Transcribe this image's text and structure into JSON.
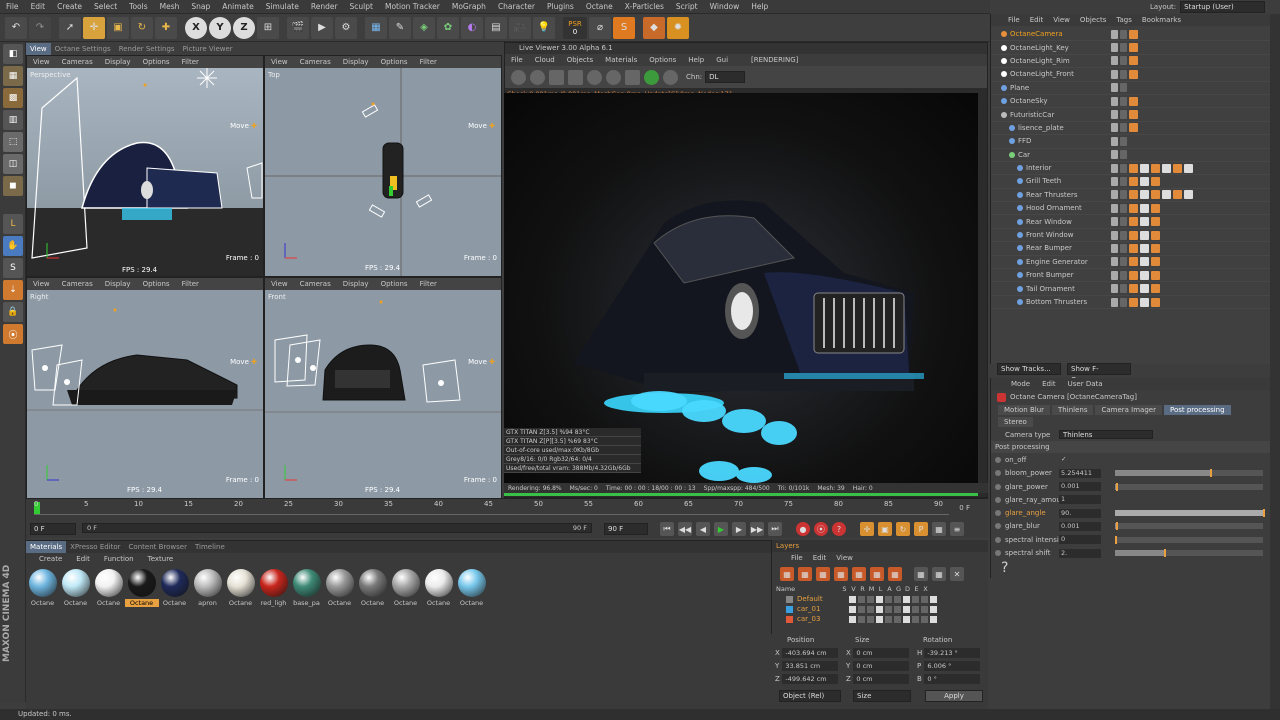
{
  "menu": [
    "File",
    "Edit",
    "Create",
    "Select",
    "Tools",
    "Mesh",
    "Snap",
    "Animate",
    "Simulate",
    "Render",
    "Sculpt",
    "Motion Tracker",
    "MoGraph",
    "Character",
    "Plugins",
    "Octane",
    "X-Particles",
    "Script",
    "Window",
    "Help"
  ],
  "layout": {
    "label": "Layout:",
    "value": "Startup (User)"
  },
  "psr": {
    "label": "PSR",
    "value": "0"
  },
  "editorTabs": [
    "View",
    "Octane Settings",
    "Render Settings",
    "Picture Viewer"
  ],
  "vpMenu": [
    "View",
    "Cameras",
    "Display",
    "Options",
    "Filter"
  ],
  "viewports": [
    {
      "name": "Perspective",
      "fps": "FPS : 29.4",
      "frame": "Frame : 0",
      "move": "Move"
    },
    {
      "name": "Top",
      "fps": "FPS : 29.4",
      "frame": "Frame : 0",
      "move": "Move"
    },
    {
      "name": "Right",
      "fps": "FPS : 29.4",
      "frame": "Frame : 0",
      "move": "Move"
    },
    {
      "name": "Front",
      "fps": "FPS : 29.4",
      "frame": "Frame : 0",
      "move": "Move"
    }
  ],
  "liveViewer": {
    "title": "Live Viewer 3.00 Alpha 6.1",
    "menu": [
      "File",
      "Cloud",
      "Objects",
      "Materials",
      "Options",
      "Help",
      "Gui"
    ],
    "rendering": "[RENDERING]",
    "chn": "Chn:",
    "chnValue": "DL",
    "check": "Check:0.001ms./0.001ms. MeshGen:0ms. Update[C]:0ms. Nodes:171",
    "stats": [
      "GTX TITAN Z[3.5]   %94   83°C",
      "GTX TITAN Z[P][3.5]   %69   83°C",
      "Out-of-core used/max:0Kb/8Gb",
      "Grey8/16: 0/0       Rgb32/64: 0/4",
      "Used/free/total vram: 388Mb/4.32Gb/6Gb"
    ],
    "status": [
      "Rendering: 96.8%",
      "Ms/sec: 0",
      "Time: 00 : 00 : 18/00 : 00 : 13",
      "Spp/maxspp: 484/500",
      "Tri: 0/101k",
      "Mesh: 39",
      "Hair: 0"
    ]
  },
  "timeline": {
    "ticks": [
      "0",
      "5",
      "10",
      "15",
      "20",
      "25",
      "30",
      "35",
      "40",
      "45",
      "50",
      "55",
      "60",
      "65",
      "70",
      "75",
      "80",
      "85",
      "90"
    ],
    "end": "0 F",
    "start": "0 F",
    "current": "0 F",
    "max": "90 F",
    "range": "90 F"
  },
  "materials": {
    "tabs": [
      "Materials",
      "XPresso Editor",
      "Content Browser",
      "Timeline"
    ],
    "menu": [
      "Create",
      "Edit",
      "Function",
      "Texture"
    ],
    "items": [
      {
        "name": "Octane",
        "color": "#6fb6e0"
      },
      {
        "name": "Octane",
        "color": "#bfe8f6"
      },
      {
        "name": "Octane",
        "color": "#f2f2f2"
      },
      {
        "name": "Octane",
        "color": "#1a1a1a"
      },
      {
        "name": "Octane",
        "color": "#1f2a5a"
      },
      {
        "name": "apron",
        "color": "#bdbdbd"
      },
      {
        "name": "Octane",
        "color": "#e6e2d6"
      },
      {
        "name": "red_ligh",
        "color": "#c8261c"
      },
      {
        "name": "base_pa",
        "color": "#3e8a76"
      },
      {
        "name": "Octane",
        "color": "#9a9a9a"
      },
      {
        "name": "Octane",
        "color": "#7a7a7a"
      },
      {
        "name": "Octane",
        "color": "#a8a8a8"
      },
      {
        "name": "Octane",
        "color": "#ececec"
      },
      {
        "name": "Octane",
        "color": "#78c8ec"
      }
    ]
  },
  "objects": {
    "menu": [
      "File",
      "Edit",
      "View",
      "Objects",
      "Tags",
      "Bookmarks"
    ],
    "rows": [
      {
        "name": "OctaneCamera",
        "color": "#e88f3c"
      },
      {
        "name": "OctaneLight_Key",
        "color": "#ffffff"
      },
      {
        "name": "OctaneLight_Rim",
        "color": "#ffffff"
      },
      {
        "name": "OctaneLight_Front",
        "color": "#ffffff"
      },
      {
        "name": "Plane",
        "color": "#6fa0e0"
      },
      {
        "name": "OctaneSky",
        "color": "#6fa0e0"
      },
      {
        "name": "FuturisticCar",
        "color": "#bbbbbb"
      },
      {
        "name": "lisence_plate",
        "color": "#6fa0e0"
      },
      {
        "name": "FFD",
        "color": "#6fa0e0"
      },
      {
        "name": "Car",
        "color": "#7ad07a"
      },
      {
        "name": "Interior",
        "color": "#6fa0e0"
      },
      {
        "name": "Grill Teeth",
        "color": "#6fa0e0"
      },
      {
        "name": "Rear Thrusters",
        "color": "#6fa0e0"
      },
      {
        "name": "Hood Ornament",
        "color": "#6fa0e0"
      },
      {
        "name": "Rear Window",
        "color": "#6fa0e0"
      },
      {
        "name": "Front Window",
        "color": "#6fa0e0"
      },
      {
        "name": "Rear Bumper",
        "color": "#6fa0e0"
      },
      {
        "name": "Engine Generator",
        "color": "#6fa0e0"
      },
      {
        "name": "Front Bumper",
        "color": "#6fa0e0"
      },
      {
        "name": "Tail Ornament",
        "color": "#6fa0e0"
      },
      {
        "name": "Bottom Thrusters",
        "color": "#6fa0e0"
      }
    ],
    "showTracks": "Show Tracks...",
    "showFCurves": "Show F-Curves..."
  },
  "attributes": {
    "menu": [
      "Mode",
      "Edit",
      "User Data"
    ],
    "title": "Octane Camera [OctaneCameraTag]",
    "tabs": [
      "Motion Blur",
      "Thinlens",
      "Camera Imager",
      "Post processing",
      "Stereo"
    ],
    "cameraTypeLabel": "Camera type",
    "cameraType": "Thinlens",
    "section": "Post processing",
    "params": [
      {
        "label": "on_off",
        "value": "✓",
        "fill": 0
      },
      {
        "label": "bloom_power",
        "value": "5.254411",
        "fill": 0.64
      },
      {
        "label": "glare_power",
        "value": "0.001",
        "fill": 0.01
      },
      {
        "label": "glare_ray_amount",
        "value": "1",
        "fill": 0
      },
      {
        "label": "glare_angle",
        "value": "90.",
        "fill": 1.0
      },
      {
        "label": "glare_blur",
        "value": "0.001",
        "fill": 0.01
      },
      {
        "label": "spectral intensity",
        "value": "0",
        "fill": 0
      },
      {
        "label": "spectral shift",
        "value": "2.",
        "fill": 0.33
      }
    ]
  },
  "layers": {
    "title": "Layers",
    "menu": [
      "File",
      "Edit",
      "View"
    ],
    "cols": [
      "Name",
      "S",
      "V",
      "R",
      "M",
      "L",
      "A",
      "G",
      "D",
      "E",
      "X"
    ],
    "rows": [
      {
        "name": "Default",
        "color": "#888"
      },
      {
        "name": "car_01",
        "color": "#3aa0e0"
      },
      {
        "name": "car_03",
        "color": "#e05a3a"
      }
    ]
  },
  "coords": {
    "headers": [
      "Position",
      "Size",
      "Rotation"
    ],
    "rows": [
      {
        "a": "X",
        "av": "-403.694 cm",
        "b": "X",
        "bv": "0 cm",
        "c": "H",
        "cv": "-39.213 °"
      },
      {
        "a": "Y",
        "av": "33.851 cm",
        "b": "Y",
        "bv": "0 cm",
        "c": "P",
        "cv": "6.006 °"
      },
      {
        "a": "Z",
        "av": "-499.642 cm",
        "b": "Z",
        "bv": "0 cm",
        "c": "B",
        "cv": "0 °"
      }
    ],
    "mode": "Object (Rel)",
    "size": "Size",
    "apply": "Apply"
  },
  "status": "Updated: 0 ms.",
  "brand": "MAXON CINEMA 4D"
}
